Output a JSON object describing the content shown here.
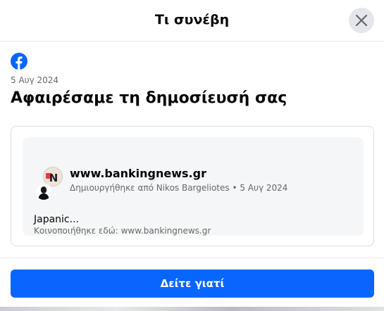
{
  "dialog": {
    "title": "Τι συνέβη",
    "close_icon": "close-icon"
  },
  "notice": {
    "brand_icon": "facebook-logo-icon",
    "brand_color": "#0866ff",
    "date": "5 Αυγ 2024",
    "headline": "Αφαιρέσαμε τη δημοσίευσή σας"
  },
  "post": {
    "page_name": "www.bankingnews.gr",
    "meta": "Δημιουργήθηκε από Nikos Bargeliotes • 5 Αυγ 2024",
    "snippet": "Japanic...",
    "shared_in": "Κοινοποιήθηκε εδώ: www.bankingnews.gr",
    "page_avatar_text": "N"
  },
  "actions": {
    "primary_label": "Δείτε γιατί",
    "primary_color": "#0866ff"
  }
}
